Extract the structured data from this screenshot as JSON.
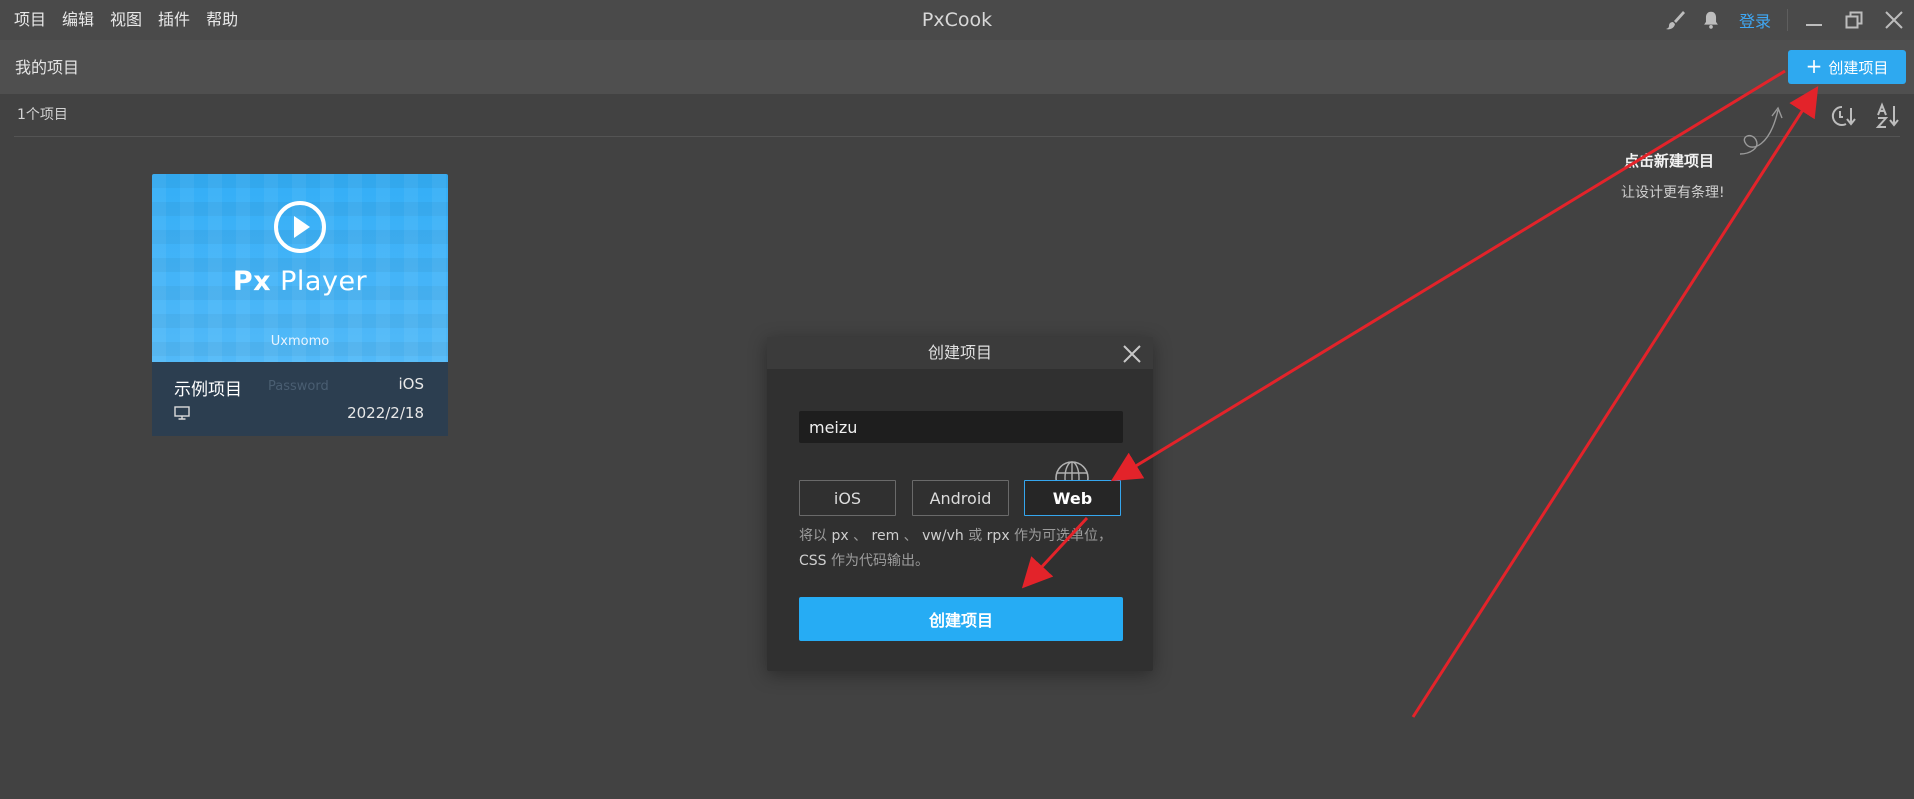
{
  "titlebar": {
    "menu": [
      {
        "name": "menu-project",
        "label": "项目"
      },
      {
        "name": "menu-edit",
        "label": "编辑"
      },
      {
        "name": "menu-view",
        "label": "视图"
      },
      {
        "name": "menu-plugins",
        "label": "插件"
      },
      {
        "name": "menu-help",
        "label": "帮助"
      }
    ],
    "app_title": "PxCook",
    "login_label": "登录",
    "icons": [
      "brush-icon",
      "bell-icon"
    ]
  },
  "header": {
    "title": "我的项目",
    "create_button": "创建项目"
  },
  "toolbar": {
    "count": "1个项目"
  },
  "hint": {
    "title": "点击新建项目",
    "subtitle": "让设计更有条理!"
  },
  "card": {
    "thumb_title_a": "Px",
    "thumb_title_b": "Player",
    "thumb_author": "Uxmomo",
    "ghost_text": "Password",
    "name": "示例项目",
    "platform": "iOS",
    "date": "2022/2/18"
  },
  "dialog": {
    "title": "创建项目",
    "input_value": "meizu",
    "platforms": [
      "iOS",
      "Android",
      "Web"
    ],
    "selected_platform": "Web",
    "desc_parts": {
      "p1": "将以 ",
      "u1": "px",
      "s1": " 、 ",
      "u2": "rem",
      "s2": " 、 ",
      "u3": "vw/vh",
      "s3": " 或 ",
      "u4": "rpx",
      "p2": " 作为可选单位，",
      "u5": "CSS",
      "p3": " 作为代码输出。"
    },
    "submit_label": "创建项目"
  },
  "colors": {
    "accent": "#26acf4",
    "annotation": "#e3232a",
    "background": "#424242"
  }
}
